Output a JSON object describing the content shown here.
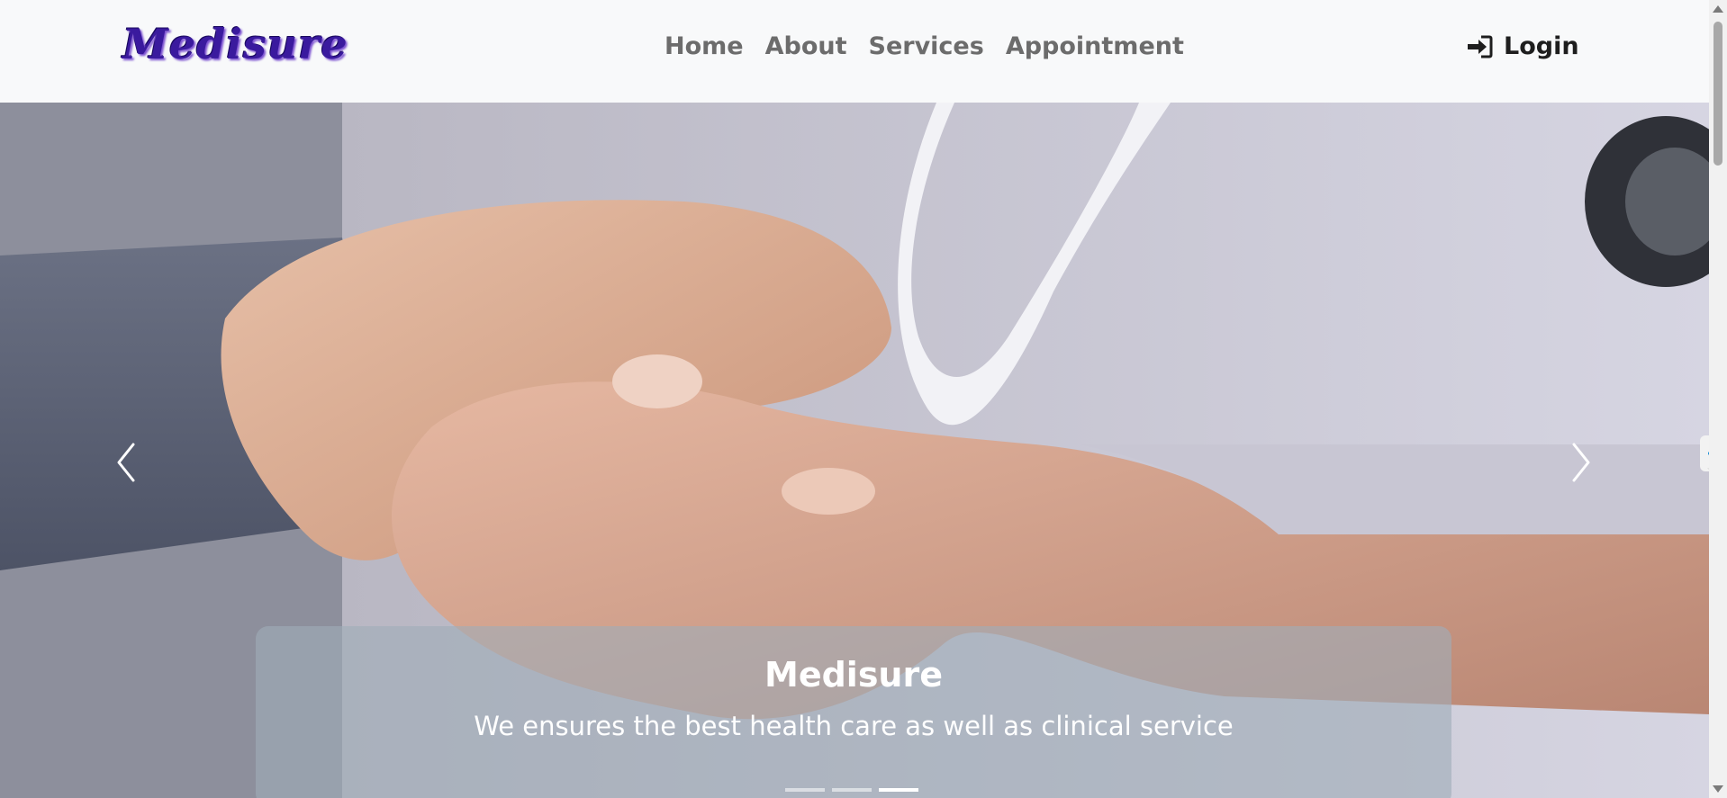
{
  "navbar": {
    "brand": "Medisure",
    "links": [
      {
        "label": "Home"
      },
      {
        "label": "About"
      },
      {
        "label": "Services"
      },
      {
        "label": "Appointment"
      }
    ],
    "login_label": "Login",
    "login_icon": "sign-in-icon"
  },
  "carousel": {
    "caption_title": "Medisure",
    "caption_text": "We ensures the best health care as well as clinical service",
    "slide_count": 3,
    "active_slide": 3,
    "prev_icon": "chevron-left-icon",
    "next_icon": "chevron-right-icon"
  },
  "side_tab": {
    "icon": "chevron-left-icon"
  },
  "colors": {
    "brand": "#3a1a9e",
    "nav_link": "#6c6c6c",
    "navbar_bg": "#f8f9fa",
    "side_tab_icon": "#1a8fd6"
  }
}
